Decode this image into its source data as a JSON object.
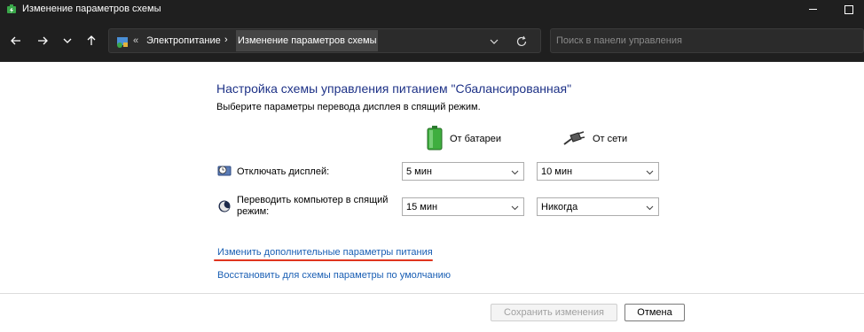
{
  "window": {
    "title": "Изменение параметров схемы"
  },
  "address": {
    "overflow": "«",
    "breadcrumbs": [
      "Электропитание",
      "Изменение параметров схемы"
    ],
    "separator": "›"
  },
  "search": {
    "placeholder": "Поиск в панели управления"
  },
  "content": {
    "heading": "Настройка схемы управления питанием \"Сбалансированная\"",
    "subheading": "Выберите параметры перевода дисплея в спящий режим.",
    "columns": {
      "battery": "От батареи",
      "plugged": "От сети"
    },
    "rows": [
      {
        "label": "Отключать дисплей:",
        "battery_value": "5 мин",
        "plugged_value": "10 мин"
      },
      {
        "label": "Переводить компьютер в спящий режим:",
        "battery_value": "15 мин",
        "plugged_value": "Никогда"
      }
    ],
    "links": {
      "advanced": "Изменить дополнительные параметры питания",
      "restore": "Восстановить для схемы параметры по умолчанию"
    }
  },
  "buttons": {
    "save": "Сохранить изменения",
    "cancel": "Отмена"
  },
  "colors": {
    "titlebar_bg": "#1f1f1f",
    "heading": "#1e3287",
    "link": "#1a5fb4",
    "highlight_underline": "#e0341e"
  },
  "icons": {
    "app": "power-options-icon",
    "battery": "battery-icon",
    "plug": "power-plug-icon",
    "display": "display-timer-icon",
    "sleep": "sleep-moon-icon"
  }
}
